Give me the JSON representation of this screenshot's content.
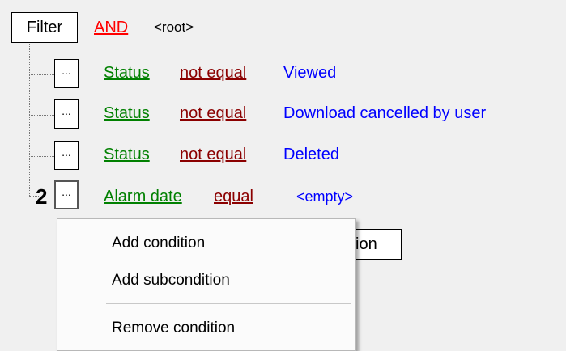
{
  "filter": {
    "button_label": "Filter",
    "operator": "AND",
    "node": "<root>"
  },
  "conditions": [
    {
      "dots": "...",
      "field": "Status",
      "op": "not equal",
      "value": "Viewed"
    },
    {
      "dots": "...",
      "field": "Status",
      "op": "not equal",
      "value": "Download cancelled by user"
    },
    {
      "dots": "...",
      "field": "Status",
      "op": "not equal",
      "value": "Deleted"
    },
    {
      "dots": "...",
      "field": "Alarm date",
      "op": "equal",
      "value": "<empty>"
    }
  ],
  "marker": "2",
  "partial_button_text": "ion",
  "context_menu": {
    "items": [
      "Add condition",
      "Add subcondition",
      "Remove condition"
    ]
  },
  "colors": {
    "field": "#008000",
    "operator": "#8b0000",
    "root_operator": "#ff0000",
    "value": "#0000ff"
  }
}
